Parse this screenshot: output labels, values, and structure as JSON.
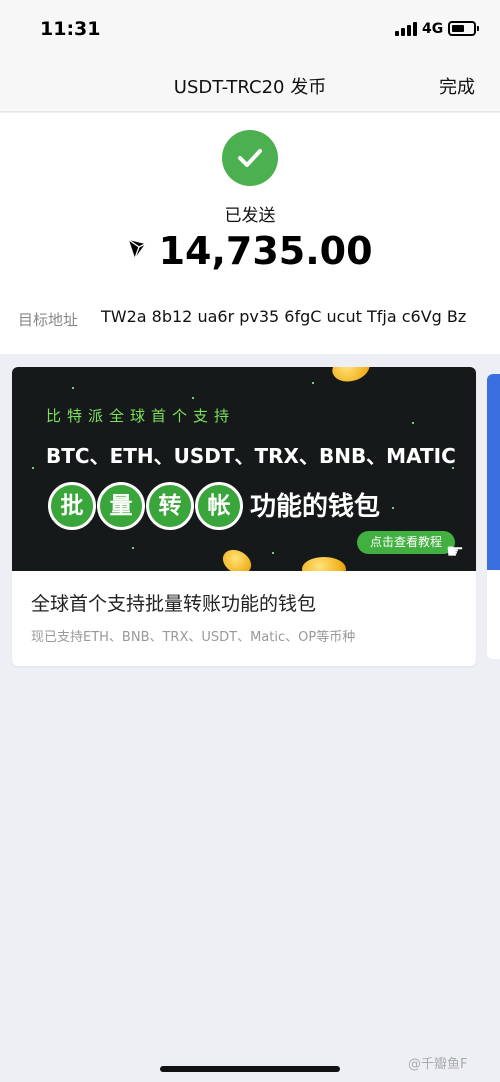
{
  "status_bar": {
    "time": "11:31",
    "network": "4G"
  },
  "nav": {
    "title": "USDT-TRC20 发币",
    "done_label": "完成"
  },
  "result": {
    "status_text": "已发送",
    "amount": "14,735.00",
    "token_icon": "tron-icon",
    "address_label": "目标地址",
    "address_value": "TW2a 8b12 ua6r pv35 6fgC ucut Tfja c6Vg Bz"
  },
  "promo": {
    "banner_subtitle": "比特派全球首个支持",
    "banner_coins": "BTC、ETH、USDT、TRX、BNB、MATIC",
    "banner_pills": [
      "批",
      "量",
      "转",
      "帐"
    ],
    "banner_tail": "功能的钱包",
    "banner_button": "点击查看教程",
    "title": "全球首个支持批量转账功能的钱包",
    "description": "现已支持ETH、BNB、TRX、USDT、Matic、OP等币种"
  },
  "watermark": "@千瓣鱼F",
  "colors": {
    "success": "#4caf50",
    "banner_bg": "#16191a",
    "banner_accent": "#3aa53a",
    "side_card": "#3b6fe0"
  }
}
